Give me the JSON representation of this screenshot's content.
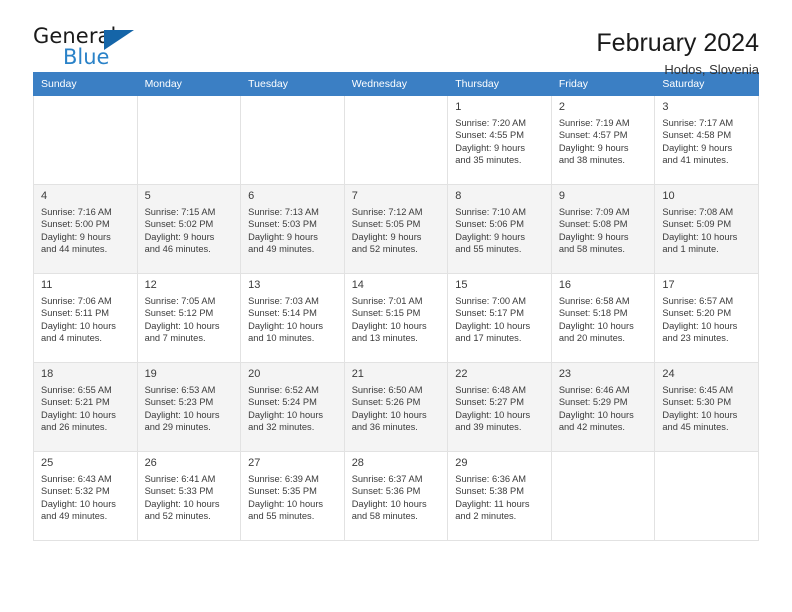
{
  "brand": {
    "name_part1": "General",
    "name_part2": "Blue",
    "triangle_icon": "triangle-icon",
    "colors": {
      "dark": "#1a1a1a",
      "blue": "#2a82c8",
      "triangle": "#1565a8"
    }
  },
  "header": {
    "title": "February 2024",
    "subtitle": "Hodos, Slovenia"
  },
  "theme": {
    "header_row_bg": "#3b7fc4",
    "header_row_text": "#ffffff",
    "shaded_row_bg": "#f4f4f4",
    "grid_line": "#e2e2e2"
  },
  "weekdays": [
    {
      "label": "Sunday"
    },
    {
      "label": "Monday"
    },
    {
      "label": "Tuesday"
    },
    {
      "label": "Wednesday"
    },
    {
      "label": "Thursday"
    },
    {
      "label": "Friday"
    },
    {
      "label": "Saturday"
    }
  ],
  "weeks": [
    {
      "shaded": false,
      "days": [
        {
          "num": "",
          "detail": "",
          "empty": true
        },
        {
          "num": "",
          "detail": "",
          "empty": true
        },
        {
          "num": "",
          "detail": "",
          "empty": true
        },
        {
          "num": "",
          "detail": "",
          "empty": true
        },
        {
          "num": "1",
          "detail": "Sunrise: 7:20 AM\nSunset: 4:55 PM\nDaylight: 9 hours\nand 35 minutes."
        },
        {
          "num": "2",
          "detail": "Sunrise: 7:19 AM\nSunset: 4:57 PM\nDaylight: 9 hours\nand 38 minutes."
        },
        {
          "num": "3",
          "detail": "Sunrise: 7:17 AM\nSunset: 4:58 PM\nDaylight: 9 hours\nand 41 minutes."
        }
      ]
    },
    {
      "shaded": true,
      "days": [
        {
          "num": "4",
          "detail": "Sunrise: 7:16 AM\nSunset: 5:00 PM\nDaylight: 9 hours\nand 44 minutes."
        },
        {
          "num": "5",
          "detail": "Sunrise: 7:15 AM\nSunset: 5:02 PM\nDaylight: 9 hours\nand 46 minutes."
        },
        {
          "num": "6",
          "detail": "Sunrise: 7:13 AM\nSunset: 5:03 PM\nDaylight: 9 hours\nand 49 minutes."
        },
        {
          "num": "7",
          "detail": "Sunrise: 7:12 AM\nSunset: 5:05 PM\nDaylight: 9 hours\nand 52 minutes."
        },
        {
          "num": "8",
          "detail": "Sunrise: 7:10 AM\nSunset: 5:06 PM\nDaylight: 9 hours\nand 55 minutes."
        },
        {
          "num": "9",
          "detail": "Sunrise: 7:09 AM\nSunset: 5:08 PM\nDaylight: 9 hours\nand 58 minutes."
        },
        {
          "num": "10",
          "detail": "Sunrise: 7:08 AM\nSunset: 5:09 PM\nDaylight: 10 hours\nand 1 minute."
        }
      ]
    },
    {
      "shaded": false,
      "days": [
        {
          "num": "11",
          "detail": "Sunrise: 7:06 AM\nSunset: 5:11 PM\nDaylight: 10 hours\nand 4 minutes."
        },
        {
          "num": "12",
          "detail": "Sunrise: 7:05 AM\nSunset: 5:12 PM\nDaylight: 10 hours\nand 7 minutes."
        },
        {
          "num": "13",
          "detail": "Sunrise: 7:03 AM\nSunset: 5:14 PM\nDaylight: 10 hours\nand 10 minutes."
        },
        {
          "num": "14",
          "detail": "Sunrise: 7:01 AM\nSunset: 5:15 PM\nDaylight: 10 hours\nand 13 minutes."
        },
        {
          "num": "15",
          "detail": "Sunrise: 7:00 AM\nSunset: 5:17 PM\nDaylight: 10 hours\nand 17 minutes."
        },
        {
          "num": "16",
          "detail": "Sunrise: 6:58 AM\nSunset: 5:18 PM\nDaylight: 10 hours\nand 20 minutes."
        },
        {
          "num": "17",
          "detail": "Sunrise: 6:57 AM\nSunset: 5:20 PM\nDaylight: 10 hours\nand 23 minutes."
        }
      ]
    },
    {
      "shaded": true,
      "days": [
        {
          "num": "18",
          "detail": "Sunrise: 6:55 AM\nSunset: 5:21 PM\nDaylight: 10 hours\nand 26 minutes."
        },
        {
          "num": "19",
          "detail": "Sunrise: 6:53 AM\nSunset: 5:23 PM\nDaylight: 10 hours\nand 29 minutes."
        },
        {
          "num": "20",
          "detail": "Sunrise: 6:52 AM\nSunset: 5:24 PM\nDaylight: 10 hours\nand 32 minutes."
        },
        {
          "num": "21",
          "detail": "Sunrise: 6:50 AM\nSunset: 5:26 PM\nDaylight: 10 hours\nand 36 minutes."
        },
        {
          "num": "22",
          "detail": "Sunrise: 6:48 AM\nSunset: 5:27 PM\nDaylight: 10 hours\nand 39 minutes."
        },
        {
          "num": "23",
          "detail": "Sunrise: 6:46 AM\nSunset: 5:29 PM\nDaylight: 10 hours\nand 42 minutes."
        },
        {
          "num": "24",
          "detail": "Sunrise: 6:45 AM\nSunset: 5:30 PM\nDaylight: 10 hours\nand 45 minutes."
        }
      ]
    },
    {
      "shaded": false,
      "days": [
        {
          "num": "25",
          "detail": "Sunrise: 6:43 AM\nSunset: 5:32 PM\nDaylight: 10 hours\nand 49 minutes."
        },
        {
          "num": "26",
          "detail": "Sunrise: 6:41 AM\nSunset: 5:33 PM\nDaylight: 10 hours\nand 52 minutes."
        },
        {
          "num": "27",
          "detail": "Sunrise: 6:39 AM\nSunset: 5:35 PM\nDaylight: 10 hours\nand 55 minutes."
        },
        {
          "num": "28",
          "detail": "Sunrise: 6:37 AM\nSunset: 5:36 PM\nDaylight: 10 hours\nand 58 minutes."
        },
        {
          "num": "29",
          "detail": "Sunrise: 6:36 AM\nSunset: 5:38 PM\nDaylight: 11 hours\nand 2 minutes."
        },
        {
          "num": "",
          "detail": "",
          "empty": true
        },
        {
          "num": "",
          "detail": "",
          "empty": true
        }
      ]
    }
  ]
}
